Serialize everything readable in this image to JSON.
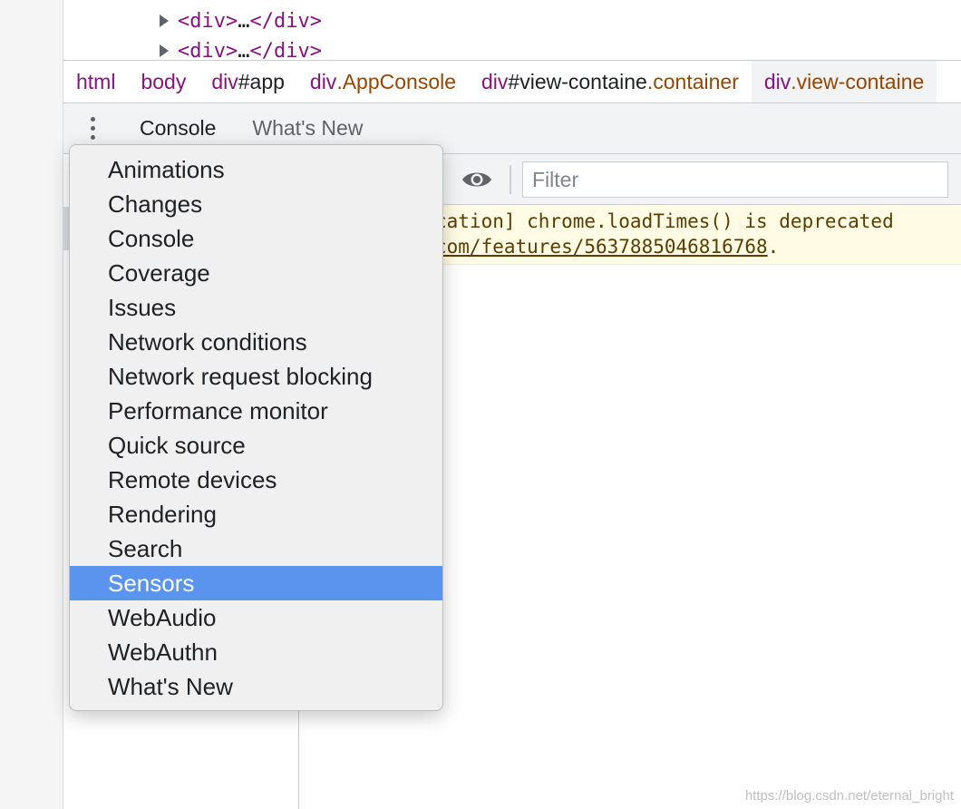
{
  "elements": {
    "lines": [
      {
        "open": "<div>",
        "ellipsis": "…",
        "close": "</div>"
      },
      {
        "open": "<div>",
        "ellipsis": "…",
        "close": "</div>"
      }
    ]
  },
  "breadcrumbs": [
    {
      "el": "html",
      "id": "",
      "cls": ""
    },
    {
      "el": "body",
      "id": "",
      "cls": ""
    },
    {
      "el": "div",
      "id": "#app",
      "cls": ""
    },
    {
      "el": "div",
      "id": "",
      "cls": ".AppConsole"
    },
    {
      "el": "div",
      "id": "#view-containe",
      "cls": ".container"
    },
    {
      "el": "div",
      "id": "",
      "cls": ".view-containe"
    }
  ],
  "drawer": {
    "tabs": [
      "Console",
      "What's New"
    ]
  },
  "console": {
    "filter_placeholder": "Filter",
    "warning_line1": "cation] chrome.loadTimes() is deprecated",
    "warning_link": "com/features/5637885046816768",
    "warning_tail": "."
  },
  "menu": {
    "items": [
      "Animations",
      "Changes",
      "Console",
      "Coverage",
      "Issues",
      "Network conditions",
      "Network request blocking",
      "Performance monitor",
      "Quick source",
      "Remote devices",
      "Rendering",
      "Search",
      "Sensors",
      "WebAudio",
      "WebAuthn",
      "What's New"
    ],
    "selected": "Sensors"
  },
  "watermark": "https://blog.csdn.net/eternal_bright",
  "colors": {
    "selection": "#5b94ef",
    "tag": "#881280",
    "class": "#994500",
    "warning_bg": "#fffbe5"
  },
  "icons": [
    "kebab-menu-icon",
    "eye-icon",
    "expand-arrow-icon"
  ]
}
